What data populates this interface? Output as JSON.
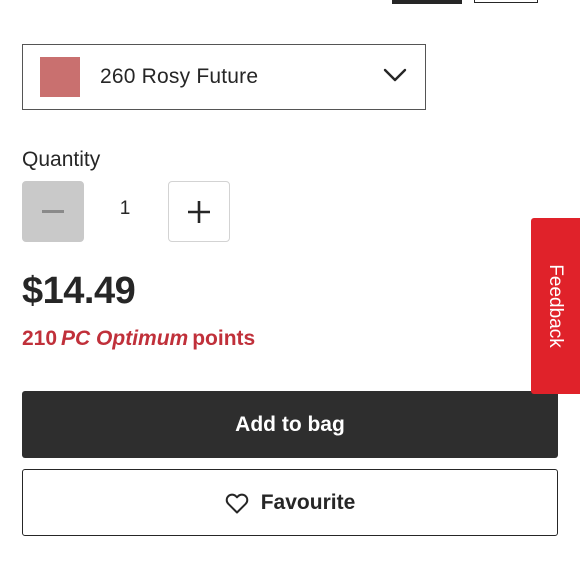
{
  "shade_selector": {
    "selected_label": "260 Rosy Future",
    "swatch_color": "#c9706f",
    "icon": "chevron-down-icon"
  },
  "quantity": {
    "label": "Quantity",
    "value": "1",
    "decrement_icon": "minus-icon",
    "increment_icon": "plus-icon"
  },
  "price": {
    "amount": "$14.49"
  },
  "points": {
    "count": "210",
    "brand": "PC Optimum",
    "suffix": "points",
    "color": "#c0303a"
  },
  "actions": {
    "add_to_bag_label": "Add to bag",
    "favourite_label": "Favourite",
    "favourite_icon": "heart-icon"
  },
  "feedback": {
    "label": "Feedback",
    "color": "#e0222a"
  }
}
